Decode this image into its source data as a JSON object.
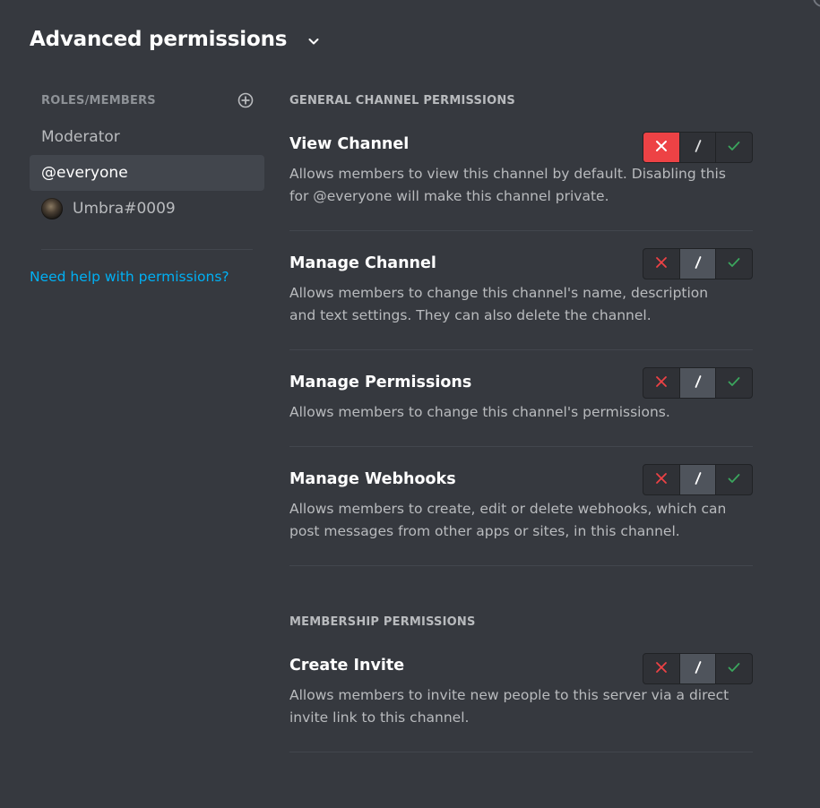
{
  "header": {
    "title": "Advanced permissions"
  },
  "sidebar": {
    "roles_heading": "ROLES/MEMBERS",
    "items": [
      {
        "label": "Moderator"
      },
      {
        "label": "@everyone"
      },
      {
        "label": "Umbra#0009"
      }
    ],
    "help_link": "Need help with permissions?"
  },
  "sections": {
    "general": {
      "heading": "GENERAL CHANNEL PERMISSIONS",
      "perms": [
        {
          "name": "View Channel",
          "desc": "Allows members to view this channel by default. Disabling this for @everyone will make this channel private.",
          "state": "deny"
        },
        {
          "name": "Manage Channel",
          "desc": "Allows members to change this channel's name, description and text settings. They can also delete the channel.",
          "state": "passthrough"
        },
        {
          "name": "Manage Permissions",
          "desc": "Allows members to change this channel's permissions.",
          "state": "passthrough"
        },
        {
          "name": "Manage Webhooks",
          "desc": "Allows members to create, edit or delete webhooks, which can post messages from other apps or sites, in this channel.",
          "state": "passthrough"
        }
      ]
    },
    "membership": {
      "heading": "MEMBERSHIP PERMISSIONS",
      "perms": [
        {
          "name": "Create Invite",
          "desc": "Allows members to invite new people to this server via a direct invite link to this channel.",
          "state": "passthrough"
        }
      ]
    }
  },
  "colors": {
    "background": "#36393f",
    "deny": "#ed4245",
    "allow": "#3ba55d",
    "link": "#00b0f4"
  },
  "icons": {
    "deny": "x-icon",
    "passthrough": "slash-icon",
    "allow": "check-icon"
  }
}
